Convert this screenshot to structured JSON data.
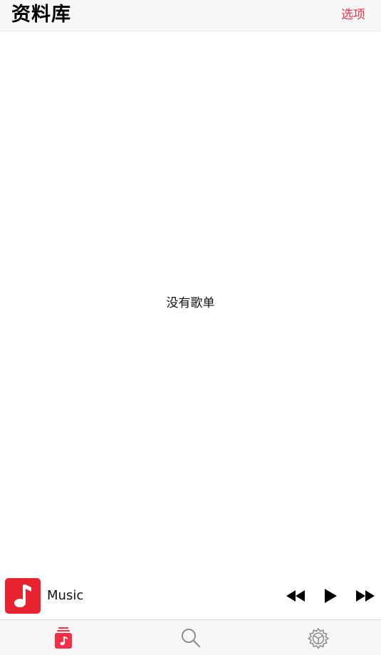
{
  "header": {
    "title": "资料库",
    "options_label": "选项"
  },
  "main": {
    "empty_message": "没有歌单"
  },
  "mini_player": {
    "artwork_icon": "music-note-icon",
    "track_title": "Music",
    "controls": [
      "rewind-icon",
      "play-icon",
      "fast-forward-icon"
    ]
  },
  "tab_bar": {
    "tabs": [
      {
        "icon": "library-icon",
        "active": true
      },
      {
        "icon": "search-icon",
        "active": false
      },
      {
        "icon": "settings-icon",
        "active": false
      }
    ]
  },
  "colors": {
    "accent": "#fa2d48",
    "artwork_bg": "#e8232f",
    "inactive_icon": "#8e8e8e",
    "header_bg": "#f7f7f7"
  }
}
